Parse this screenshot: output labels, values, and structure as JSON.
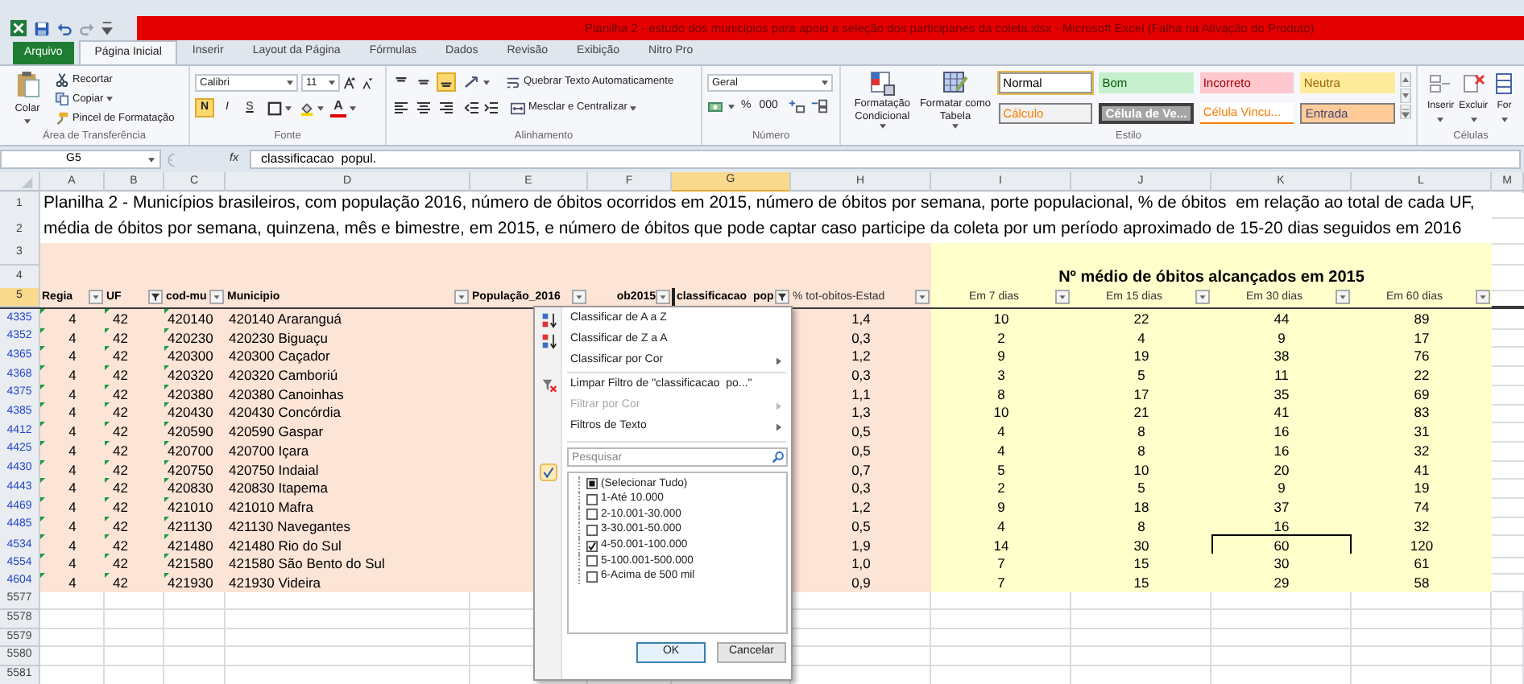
{
  "window": {
    "title": "Planilha 2 - estudo dos municipios para apoio a seleção dos participanes da coleta.xlsx - Microsoft Excel (Falha na Ativação do Produto)"
  },
  "ribbon_tabs": [
    {
      "label": "Arquivo",
      "kind": "file",
      "selected": false
    },
    {
      "label": "Página Inicial",
      "kind": "tab",
      "selected": true
    },
    {
      "label": "Inserir",
      "kind": "tab",
      "selected": false
    },
    {
      "label": "Layout da Página",
      "kind": "tab",
      "selected": false
    },
    {
      "label": "Fórmulas",
      "kind": "tab",
      "selected": false
    },
    {
      "label": "Dados",
      "kind": "tab",
      "selected": false
    },
    {
      "label": "Revisão",
      "kind": "tab",
      "selected": false
    },
    {
      "label": "Exibição",
      "kind": "tab",
      "selected": false
    },
    {
      "label": "Nitro Pro",
      "kind": "tab",
      "selected": false
    }
  ],
  "clipboard": {
    "paste": "Colar",
    "items": [
      {
        "label": "Recortar",
        "kind": "cut"
      },
      {
        "label": "Copiar",
        "kind": "copy"
      },
      {
        "label": "Pincel de Formatação",
        "kind": "painter"
      }
    ],
    "group_label": "Área de Transferência"
  },
  "font": {
    "name": "Calibri",
    "size": "11",
    "styles": [
      {
        "label": "N",
        "kind": "bold",
        "selected": true
      },
      {
        "label": "I",
        "kind": "italic",
        "selected": false
      },
      {
        "label": "S",
        "kind": "underline",
        "selected": false
      }
    ],
    "color_label": "A",
    "group_label": "Fonte"
  },
  "alignment": {
    "vertical": [
      {
        "selected": false
      },
      {
        "selected": false
      },
      {
        "selected": true
      }
    ],
    "wrap": "Quebrar Texto Automaticamente",
    "merge": "Mesclar e Centralizar",
    "group_label": "Alinhamento"
  },
  "number": {
    "format": "Geral",
    "buttons": [
      "%",
      "000"
    ],
    "group_label": "Número"
  },
  "styles": {
    "conditional": "Formatação Condicional",
    "as_table": "Formatar como Tabela",
    "gallery": [
      {
        "label": "Normal",
        "kind": "normal",
        "selected": true
      },
      {
        "label": "Bom",
        "kind": "good",
        "selected": false
      },
      {
        "label": "Incorreto",
        "kind": "bad",
        "selected": false
      },
      {
        "label": "Neutra",
        "kind": "neutral",
        "selected": false
      },
      {
        "label": "Cálculo",
        "kind": "calculation",
        "selected": false
      },
      {
        "label": "Célula de Ve...",
        "kind": "check",
        "selected": false
      },
      {
        "label": "Célula Vincu...",
        "kind": "linked",
        "selected": false
      },
      {
        "label": "Entrada",
        "kind": "input",
        "selected": false
      }
    ],
    "group_label": "Estilo"
  },
  "cells": {
    "buttons": [
      "Inserir",
      "Excluir",
      "For"
    ],
    "group_label": "Células"
  },
  "formula_bar": {
    "name_box": "G5",
    "function_label": "fx",
    "formula": "classificacao  popul."
  },
  "columns": [
    {
      "label": "A",
      "selected": false
    },
    {
      "label": "B",
      "selected": false
    },
    {
      "label": "C",
      "selected": false
    },
    {
      "label": "D",
      "selected": false
    },
    {
      "label": "E",
      "selected": false
    },
    {
      "label": "F",
      "selected": false
    },
    {
      "label": "G",
      "selected": true
    },
    {
      "label": "H",
      "selected": false
    },
    {
      "label": "I",
      "selected": false
    },
    {
      "label": "J",
      "selected": false
    },
    {
      "label": "K",
      "selected": false
    },
    {
      "label": "L",
      "selected": false
    },
    {
      "label": "M",
      "selected": false
    }
  ],
  "title_lines": [
    {
      "row": "1",
      "text": "Planilha 2 - Municípios brasileiros, com população 2016, número de óbitos ocorridos em 2015, número de óbitos por semana, porte populacional, % de óbitos  em relação ao total de cada UF,"
    },
    {
      "row": "2",
      "text": "média de óbitos por semana, quinzena, mês e bimestre, em 2015, e número de óbitos que pode captar caso participe da coleta por um período aproximado de 15-20 dias seguidos em 2016"
    }
  ],
  "band": {
    "rows": [
      "3",
      "4"
    ],
    "title": "Nº médio de óbitos alcançados em 2015"
  },
  "header_row": {
    "row": "5",
    "selected": true,
    "columns": [
      {
        "label": "Regia",
        "filtered": false,
        "selected": false
      },
      {
        "label": "UF",
        "filtered": true,
        "selected": false
      },
      {
        "label": "cod-mu",
        "filtered": false,
        "selected": false
      },
      {
        "label": "Municipio",
        "filtered": false,
        "selected": false
      },
      {
        "label": "População_2016",
        "filtered": false,
        "selected": false
      },
      {
        "label": "ob2015",
        "filtered": false,
        "selected": false
      },
      {
        "label": "classificacao  pop",
        "filtered": true,
        "selected": true
      },
      {
        "label": "% tot-obitos-Estad",
        "filtered": false,
        "selected": false
      },
      {
        "label": "Em 7 dias",
        "filtered": false,
        "selected": false
      },
      {
        "label": "Em 15 dias",
        "filtered": false,
        "selected": false
      },
      {
        "label": "Em 30 dias",
        "filtered": false,
        "selected": false
      },
      {
        "label": "Em 60 dias",
        "filtered": false,
        "selected": false
      }
    ]
  },
  "data_rows": [
    {
      "row": "4335",
      "filtered": true,
      "cells": [
        {
          "text": "4",
          "selected": false
        },
        {
          "text": "42",
          "selected": false
        },
        {
          "text": "420140",
          "selected": false
        },
        {
          "text": "420140 Araranguá",
          "selected": false
        },
        {
          "text": "1,4",
          "selected": false
        },
        {
          "text": "10",
          "selected": false
        },
        {
          "text": "22",
          "selected": false
        },
        {
          "text": "44",
          "selected": false
        },
        {
          "text": "89",
          "selected": false
        }
      ]
    },
    {
      "row": "4352",
      "filtered": true,
      "cells": [
        {
          "text": "4",
          "selected": false
        },
        {
          "text": "42",
          "selected": false
        },
        {
          "text": "420230",
          "selected": false
        },
        {
          "text": "420230 Biguaçu",
          "selected": false
        },
        {
          "text": "0,3",
          "selected": false
        },
        {
          "text": "2",
          "selected": false
        },
        {
          "text": "4",
          "selected": false
        },
        {
          "text": "9",
          "selected": false
        },
        {
          "text": "17",
          "selected": false
        }
      ]
    },
    {
      "row": "4365",
      "filtered": true,
      "cells": [
        {
          "text": "4",
          "selected": false
        },
        {
          "text": "42",
          "selected": false
        },
        {
          "text": "420300",
          "selected": false
        },
        {
          "text": "420300 Caçador",
          "selected": false
        },
        {
          "text": "1,2",
          "selected": false
        },
        {
          "text": "9",
          "selected": false
        },
        {
          "text": "19",
          "selected": false
        },
        {
          "text": "38",
          "selected": false
        },
        {
          "text": "76",
          "selected": false
        }
      ]
    },
    {
      "row": "4368",
      "filtered": true,
      "cells": [
        {
          "text": "4",
          "selected": false
        },
        {
          "text": "42",
          "selected": false
        },
        {
          "text": "420320",
          "selected": false
        },
        {
          "text": "420320 Camboriú",
          "selected": false
        },
        {
          "text": "0,3",
          "selected": false
        },
        {
          "text": "3",
          "selected": false
        },
        {
          "text": "5",
          "selected": false
        },
        {
          "text": "11",
          "selected": false
        },
        {
          "text": "22",
          "selected": false
        }
      ]
    },
    {
      "row": "4375",
      "filtered": true,
      "cells": [
        {
          "text": "4",
          "selected": false
        },
        {
          "text": "42",
          "selected": false
        },
        {
          "text": "420380",
          "selected": false
        },
        {
          "text": "420380 Canoinhas",
          "selected": false
        },
        {
          "text": "1,1",
          "selected": false
        },
        {
          "text": "8",
          "selected": false
        },
        {
          "text": "17",
          "selected": false
        },
        {
          "text": "35",
          "selected": false
        },
        {
          "text": "69",
          "selected": false
        }
      ]
    },
    {
      "row": "4385",
      "filtered": true,
      "cells": [
        {
          "text": "4",
          "selected": false
        },
        {
          "text": "42",
          "selected": false
        },
        {
          "text": "420430",
          "selected": false
        },
        {
          "text": "420430 Concórdia",
          "selected": false
        },
        {
          "text": "1,3",
          "selected": false
        },
        {
          "text": "10",
          "selected": false
        },
        {
          "text": "21",
          "selected": false
        },
        {
          "text": "41",
          "selected": false
        },
        {
          "text": "83",
          "selected": false
        }
      ]
    },
    {
      "row": "4412",
      "filtered": true,
      "cells": [
        {
          "text": "4",
          "selected": false
        },
        {
          "text": "42",
          "selected": false
        },
        {
          "text": "420590",
          "selected": false
        },
        {
          "text": "420590 Gaspar",
          "selected": false
        },
        {
          "text": "0,5",
          "selected": false
        },
        {
          "text": "4",
          "selected": false
        },
        {
          "text": "8",
          "selected": false
        },
        {
          "text": "16",
          "selected": false
        },
        {
          "text": "31",
          "selected": false
        }
      ]
    },
    {
      "row": "4425",
      "filtered": true,
      "cells": [
        {
          "text": "4",
          "selected": false
        },
        {
          "text": "42",
          "selected": false
        },
        {
          "text": "420700",
          "selected": false
        },
        {
          "text": "420700 Içara",
          "selected": false
        },
        {
          "text": "0,5",
          "selected": false
        },
        {
          "text": "4",
          "selected": false
        },
        {
          "text": "8",
          "selected": false
        },
        {
          "text": "16",
          "selected": false
        },
        {
          "text": "32",
          "selected": false
        }
      ]
    },
    {
      "row": "4430",
      "filtered": true,
      "cells": [
        {
          "text": "4",
          "selected": false
        },
        {
          "text": "42",
          "selected": false
        },
        {
          "text": "420750",
          "selected": false
        },
        {
          "text": "420750 Indaial",
          "selected": false
        },
        {
          "text": "0,7",
          "selected": false
        },
        {
          "text": "5",
          "selected": false
        },
        {
          "text": "10",
          "selected": false
        },
        {
          "text": "20",
          "selected": false
        },
        {
          "text": "41",
          "selected": false
        }
      ]
    },
    {
      "row": "4443",
      "filtered": true,
      "cells": [
        {
          "text": "4",
          "selected": false
        },
        {
          "text": "42",
          "selected": false
        },
        {
          "text": "420830",
          "selected": false
        },
        {
          "text": "420830 Itapema",
          "selected": false
        },
        {
          "text": "0,3",
          "selected": false
        },
        {
          "text": "2",
          "selected": false
        },
        {
          "text": "5",
          "selected": false
        },
        {
          "text": "9",
          "selected": false
        },
        {
          "text": "19",
          "selected": false
        }
      ]
    },
    {
      "row": "4469",
      "filtered": true,
      "cells": [
        {
          "text": "4",
          "selected": false
        },
        {
          "text": "42",
          "selected": false
        },
        {
          "text": "421010",
          "selected": false
        },
        {
          "text": "421010 Mafra",
          "selected": false
        },
        {
          "text": "1,2",
          "selected": false
        },
        {
          "text": "9",
          "selected": false
        },
        {
          "text": "18",
          "selected": false
        },
        {
          "text": "37",
          "selected": false
        },
        {
          "text": "74",
          "selected": false
        }
      ]
    },
    {
      "row": "4485",
      "filtered": true,
      "cells": [
        {
          "text": "4",
          "selected": false
        },
        {
          "text": "42",
          "selected": false
        },
        {
          "text": "421130",
          "selected": false
        },
        {
          "text": "421130 Navegantes",
          "selected": false
        },
        {
          "text": "0,5",
          "selected": false
        },
        {
          "text": "4",
          "selected": false
        },
        {
          "text": "8",
          "selected": false
        },
        {
          "text": "16",
          "selected": false
        },
        {
          "text": "32",
          "selected": false
        }
      ]
    },
    {
      "row": "4534",
      "filtered": true,
      "cells": [
        {
          "text": "4",
          "selected": false
        },
        {
          "text": "42",
          "selected": false
        },
        {
          "text": "421480",
          "selected": false
        },
        {
          "text": "421480 Rio do Sul",
          "selected": false
        },
        {
          "text": "1,9",
          "selected": false
        },
        {
          "text": "14",
          "selected": false
        },
        {
          "text": "30",
          "selected": false
        },
        {
          "text": "60",
          "selected": true
        },
        {
          "text": "120",
          "selected": false
        }
      ]
    },
    {
      "row": "4554",
      "filtered": true,
      "cells": [
        {
          "text": "4",
          "selected": false
        },
        {
          "text": "42",
          "selected": false
        },
        {
          "text": "421580",
          "selected": false
        },
        {
          "text": "421580 São Bento do Sul",
          "selected": false
        },
        {
          "text": "1,0",
          "selected": false
        },
        {
          "text": "7",
          "selected": false
        },
        {
          "text": "15",
          "selected": false
        },
        {
          "text": "30",
          "selected": false
        },
        {
          "text": "61",
          "selected": false
        }
      ]
    },
    {
      "row": "4604",
      "filtered": true,
      "cells": [
        {
          "text": "4",
          "selected": false
        },
        {
          "text": "42",
          "selected": false
        },
        {
          "text": "421930",
          "selected": false
        },
        {
          "text": "421930 Videira",
          "selected": false
        },
        {
          "text": "0,9",
          "selected": false
        },
        {
          "text": "7",
          "selected": false
        },
        {
          "text": "15",
          "selected": false
        },
        {
          "text": "29",
          "selected": false
        },
        {
          "text": "58",
          "selected": false
        }
      ]
    }
  ],
  "empty_rows": [
    {
      "row": "5577",
      "filtered": false
    },
    {
      "row": "5578",
      "filtered": false
    },
    {
      "row": "5579",
      "filtered": false
    },
    {
      "row": "5580",
      "filtered": false
    },
    {
      "row": "5581",
      "filtered": false
    }
  ],
  "filter_menu": {
    "items": [
      {
        "label": "Classificar de A a Z",
        "kind": "sort-asc",
        "disabled": false
      },
      {
        "label": "Classificar de Z a A",
        "kind": "sort-desc",
        "disabled": false
      },
      {
        "label": "Classificar por Cor",
        "kind": "submenu",
        "disabled": false
      },
      {
        "label": "Limpar Filtro de \"classificacao  po...\"",
        "kind": "clear",
        "disabled": false
      },
      {
        "label": "Filtrar por Cor",
        "kind": "submenu",
        "disabled": true
      },
      {
        "label": "Filtros de Texto",
        "kind": "submenu",
        "disabled": false
      }
    ],
    "search": {
      "placeholder": "Pesquisar"
    },
    "values": [
      {
        "label": "(Selecionar Tudo)",
        "checked": false,
        "mixed": true
      },
      {
        "label": "1-Até 10.000",
        "checked": false,
        "mixed": false
      },
      {
        "label": "2-10.001-30.000",
        "checked": false,
        "mixed": false
      },
      {
        "label": "3-30.001-50.000",
        "checked": false,
        "mixed": false
      },
      {
        "label": "4-50.001-100.000",
        "checked": true,
        "mixed": false
      },
      {
        "label": "5-100.001-500.000",
        "checked": false,
        "mixed": false
      },
      {
        "label": "6-Acima de 500 mil",
        "checked": false,
        "mixed": false
      }
    ],
    "buttons": [
      {
        "label": "OK",
        "kind": "default"
      },
      {
        "label": "Cancelar",
        "kind": "normal"
      }
    ]
  }
}
